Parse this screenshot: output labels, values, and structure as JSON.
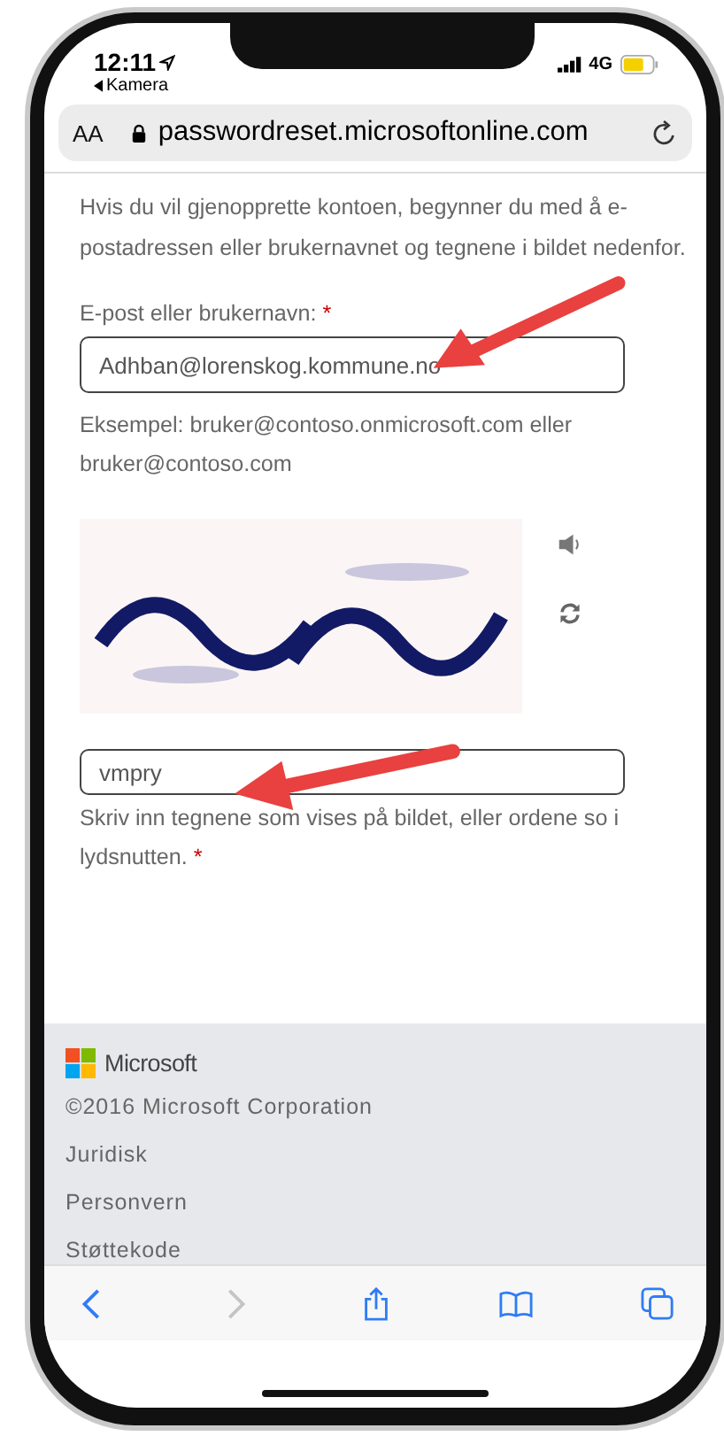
{
  "status_bar": {
    "time": "12:11",
    "back_app": "Kamera",
    "network": "4G"
  },
  "address_bar": {
    "text_size": "AA",
    "url": "passwordreset.microsoftonline.com"
  },
  "intro": "Hvis du vil gjenopprette kontoen, begynner du med å e-postadressen eller brukernavnet og tegnene i bildet nedenfor.",
  "email": {
    "label": "E-post eller brukernavn:",
    "required_mark": "*",
    "value": "Adhban@lorenskog.kommune.no",
    "hint": "Eksempel: bruker@contoso.onmicrosoft.com eller bruker@contoso.com"
  },
  "captcha": {
    "answer": "vmpry",
    "hint": "Skriv inn tegnene som vises på bildet, eller ordene so i lydsnutten.",
    "required_mark": "*"
  },
  "footer": {
    "brand": "Microsoft",
    "copyright": "©2016 Microsoft Corporation",
    "links": [
      "Juridisk",
      "Personvern",
      "Støttekode"
    ]
  },
  "toolbar": [
    {
      "kind": "back",
      "disabled": false
    },
    {
      "kind": "forward",
      "disabled": true
    },
    {
      "kind": "share",
      "disabled": false
    },
    {
      "kind": "bookmarks",
      "disabled": false
    },
    {
      "kind": "tabs",
      "disabled": false
    }
  ]
}
